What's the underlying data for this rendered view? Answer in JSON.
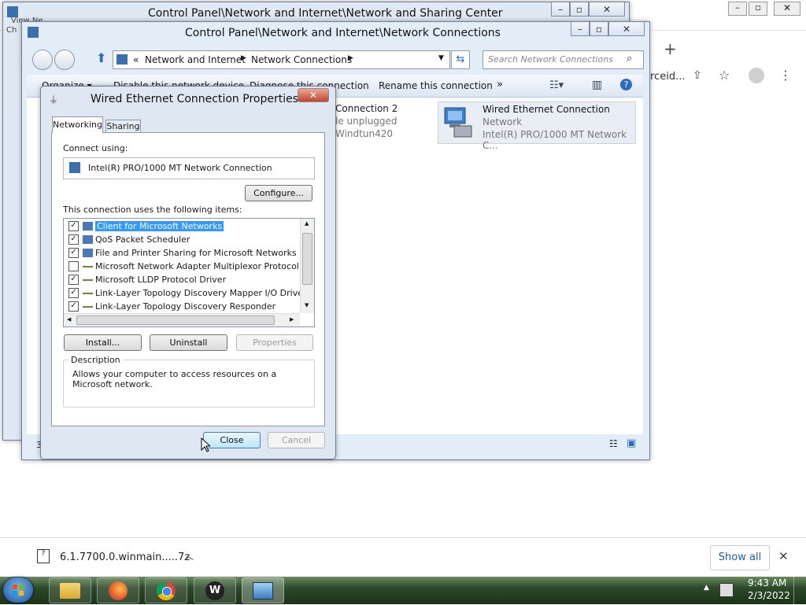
{
  "browser": {
    "header_text": "rceid...",
    "download": {
      "filename": "6.1.7700.0.winmain.....7z",
      "show_all": "Show all"
    }
  },
  "sharing_center": {
    "title": "Control Panel\\Network and Internet\\Network and Sharing Center",
    "left_label": "View Ne",
    "left_label2": "Ch"
  },
  "connections_window": {
    "title": "Control Panel\\Network and Internet\\Network Connections",
    "breadcrumb": [
      "«",
      "Network and Internet",
      "Network Connections"
    ],
    "search_placeholder": "Search Network Connections",
    "toolbar": [
      "Organize ▾",
      "Disable this network device",
      "Diagnose this connection",
      "Rename this connection",
      "»"
    ],
    "connections": [
      {
        "name": "Connection 2",
        "status": "le unplugged",
        "device": "Windtun420"
      },
      {
        "name": "Wired Ethernet Connection",
        "status": "Network",
        "device": "Intel(R) PRO/1000 MT Network C..."
      }
    ],
    "status_left": "3"
  },
  "dialog": {
    "title": "Wired Ethernet Connection Properties",
    "tabs": [
      "Networking",
      "Sharing"
    ],
    "connect_using_label": "Connect using:",
    "adapter_name": "Intel(R) PRO/1000 MT Network Connection",
    "configure_label": "Configure...",
    "items_label": "This connection uses the following items:",
    "items": [
      {
        "label": "Client for Microsoft Networks",
        "checked": true,
        "selected": true
      },
      {
        "label": "QoS Packet Scheduler",
        "checked": true,
        "selected": false
      },
      {
        "label": "File and Printer Sharing for Microsoft Networks",
        "checked": true,
        "selected": false
      },
      {
        "label": "Microsoft Network Adapter Multiplexor Protocol",
        "checked": false,
        "selected": false
      },
      {
        "label": "Microsoft LLDP Protocol Driver",
        "checked": true,
        "selected": false
      },
      {
        "label": "Link-Layer Topology Discovery Mapper I/O Driver",
        "checked": true,
        "selected": false
      },
      {
        "label": "Link-Layer Topology Discovery Responder",
        "checked": true,
        "selected": false
      }
    ],
    "install_label": "Install...",
    "uninstall_label": "Uninstall",
    "properties_label": "Properties",
    "description_title": "Description",
    "description_text": "Allows your computer to access resources on a Microsoft network.",
    "close_label": "Close",
    "cancel_label": "Cancel"
  },
  "taskbar": {
    "time": "9:43 AM",
    "date": "2/3/2022"
  }
}
